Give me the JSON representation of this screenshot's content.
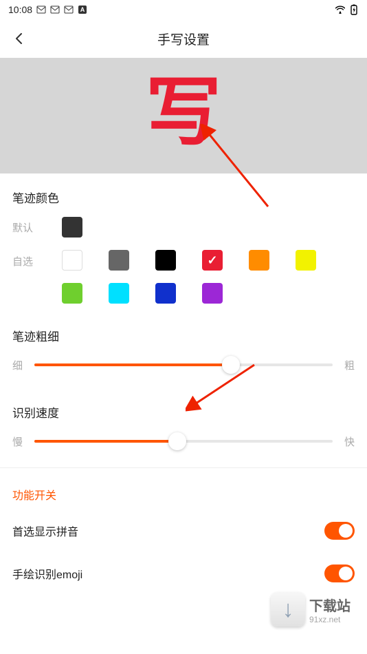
{
  "status": {
    "time": "10:08"
  },
  "header": {
    "title": "手写设置"
  },
  "preview": {
    "sample_char": "写"
  },
  "stroke_color": {
    "title": "笔迹颜色",
    "default_label": "默认",
    "custom_label": "自选",
    "default_swatch": "#333333",
    "custom_swatches": [
      "#ffffff",
      "#666666",
      "#000000",
      "#e91e33",
      "#ff8c00",
      "#f2f200",
      "#6fcf2e",
      "#00e0ff",
      "#1030cc",
      "#9c27d6"
    ],
    "selected_index": 3
  },
  "stroke_width": {
    "title": "笔迹粗细",
    "min_label": "细",
    "max_label": "粗",
    "value_pct": 66
  },
  "recognition_speed": {
    "title": "识别速度",
    "min_label": "慢",
    "max_label": "快",
    "value_pct": 48
  },
  "switches": {
    "section_title": "功能开关",
    "pinyin": {
      "label": "首选显示拼音",
      "on": true
    },
    "emoji": {
      "label": "手绘识别emoji",
      "on": true
    }
  },
  "watermark": {
    "cn": "下载站",
    "url": "91xz.net"
  }
}
